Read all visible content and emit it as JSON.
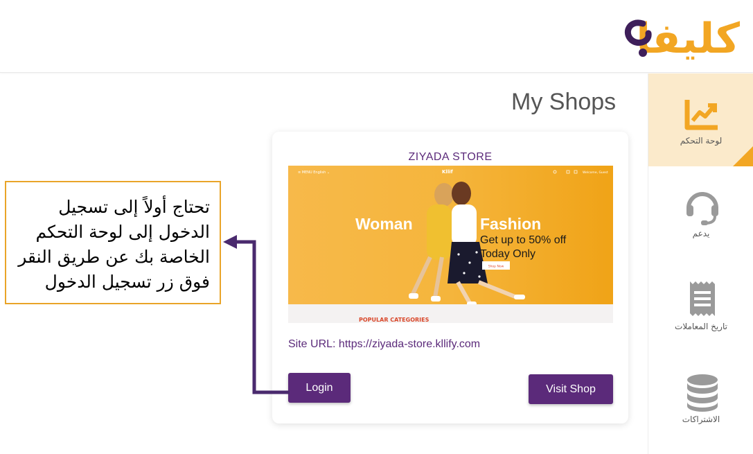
{
  "brand": {
    "logo_text": "كليفا",
    "primary_color": "#5b2a7a",
    "accent_color": "#f2a623"
  },
  "page": {
    "title": "My Shops"
  },
  "sidebar": {
    "items": [
      {
        "label": "لوحة التحكم",
        "icon": "chart-icon",
        "active": true
      },
      {
        "label": "يدعم",
        "icon": "headset-icon",
        "active": false
      },
      {
        "label": "تاريخ المعاملات",
        "icon": "receipt-icon",
        "active": false
      },
      {
        "label": "الاشتراكات",
        "icon": "database-icon",
        "active": false
      }
    ]
  },
  "shop_card": {
    "store_name": "ZIYADA STORE",
    "preview": {
      "menu_label": "≡ MENU  English  ⌄",
      "site_logo": "Kllif",
      "header_user": "Welcome, Guest",
      "banner_left": "Woman",
      "banner_right": "Fashion",
      "banner_offer_1": "Get up to 50% off",
      "banner_offer_2": "Today Only",
      "banner_button": "Shop Now",
      "section_title": "POPULAR CATEGORIES"
    },
    "site_url": "Site URL: https://ziyada-store.kllify.com",
    "login_label": "Login",
    "visit_label": "Visit Shop"
  },
  "callout": {
    "text": "تحتاج أولاً إلى تسجيل الدخول إلى لوحة التحكم الخاصة بك عن طريق النقر فوق زر تسجيل الدخول"
  }
}
